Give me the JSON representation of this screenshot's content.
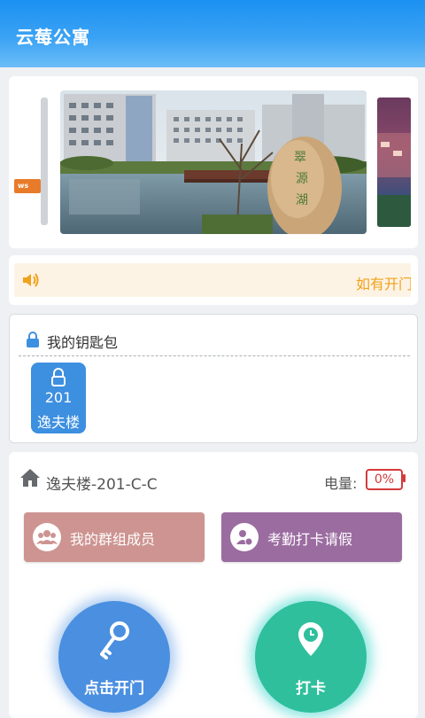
{
  "header": {
    "title": "云莓公寓"
  },
  "banner": {
    "left_tag": "ws",
    "carousel_index": 1,
    "carousel_count": 2
  },
  "notice": {
    "text": "如有开门"
  },
  "keys": {
    "title": "我的钥匙包",
    "items": [
      {
        "room": "201",
        "building": "逸夫楼"
      }
    ]
  },
  "room": {
    "name": "逸夫楼-201-C-C",
    "battery_label": "电量:",
    "battery_value": "0%"
  },
  "actions": {
    "group_members": "我的群组成员",
    "attendance_leave": "考勤打卡请假",
    "open_door": "点击开门",
    "clock_in": "打卡"
  },
  "colors": {
    "header_blue": "#1b91f2",
    "group_btn": "#cd9491",
    "attend_btn": "#9b6ca0",
    "open_btn": "#4a8fe0",
    "clock_btn": "#2fbf9c",
    "battery_red": "#d43a3a",
    "notice_orange": "#f0a21b"
  },
  "icons": {
    "notice": "speaker-icon",
    "keys": "lock-icon",
    "room": "home-icon",
    "group": "group-icon",
    "attendance": "person-clock-icon",
    "open": "key-icon",
    "clock": "location-clock-icon"
  }
}
